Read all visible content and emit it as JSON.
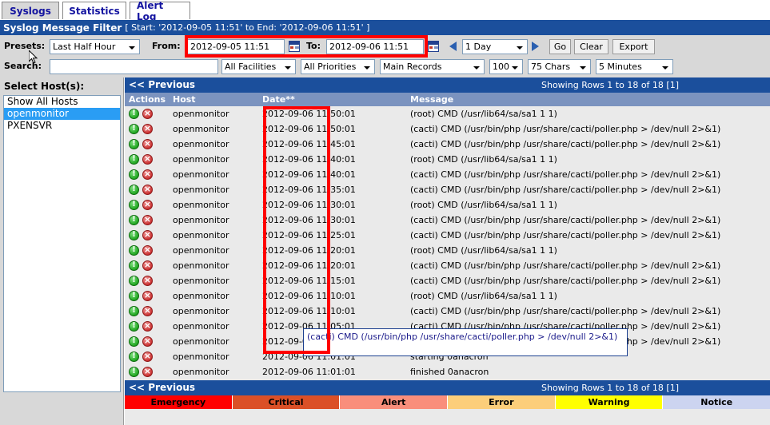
{
  "tabs": [
    {
      "label": "Syslogs",
      "active": true
    },
    {
      "label": "Statistics",
      "active": false
    },
    {
      "label": "Alert Log",
      "active": false
    }
  ],
  "filter_header": {
    "title": "Syslog Message Filter",
    "range": "[ Start: '2012-09-05 11:51' to End: '2012-09-06 11:51' ]"
  },
  "filter_form": {
    "presets_label": "Presets:",
    "presets_value": "Last Half Hour",
    "from_label": "From:",
    "from_value": "2012-09-05 11:51",
    "to_label": "To:",
    "to_value": "2012-09-06 11:51",
    "interval_value": "1 Day",
    "go_label": "Go",
    "clear_label": "Clear",
    "export_label": "Export",
    "search_label": "Search:",
    "search_value": "",
    "search_placeholder": "",
    "facilities_value": "All Facilities",
    "priorities_value": "All Priorities",
    "records_value": "Main Records",
    "rowcount_value": "100",
    "chars_value": "75 Chars",
    "refresh_value": "5 Minutes"
  },
  "hosts_panel": {
    "title": "Select Host(s):",
    "items": [
      {
        "label": "Show All Hosts",
        "selected": false
      },
      {
        "label": "openmonitor",
        "selected": true
      },
      {
        "label": "PXENSVR",
        "selected": false
      }
    ]
  },
  "pager": {
    "previous_label": "<< Previous",
    "showing_label": "Showing Rows 1 to 18 of 18 [1]"
  },
  "table": {
    "columns": [
      "Actions",
      "Host",
      "Date**",
      "Message"
    ],
    "rows": [
      {
        "host": "openmonitor",
        "date": "2012-09-06 11:50:01",
        "message": "(root) CMD (/usr/lib64/sa/sa1 1 1)"
      },
      {
        "host": "openmonitor",
        "date": "2012-09-06 11:50:01",
        "message": "(cacti) CMD (/usr/bin/php /usr/share/cacti/poller.php > /dev/null 2>&1)"
      },
      {
        "host": "openmonitor",
        "date": "2012-09-06 11:45:01",
        "message": "(cacti) CMD (/usr/bin/php /usr/share/cacti/poller.php > /dev/null 2>&1)"
      },
      {
        "host": "openmonitor",
        "date": "2012-09-06 11:40:01",
        "message": "(root) CMD (/usr/lib64/sa/sa1 1 1)"
      },
      {
        "host": "openmonitor",
        "date": "2012-09-06 11:40:01",
        "message": "(cacti) CMD (/usr/bin/php /usr/share/cacti/poller.php > /dev/null 2>&1)"
      },
      {
        "host": "openmonitor",
        "date": "2012-09-06 11:35:01",
        "message": "(cacti) CMD (/usr/bin/php /usr/share/cacti/poller.php > /dev/null 2>&1)"
      },
      {
        "host": "openmonitor",
        "date": "2012-09-06 11:30:01",
        "message": "(root) CMD (/usr/lib64/sa/sa1 1 1)"
      },
      {
        "host": "openmonitor",
        "date": "2012-09-06 11:30:01",
        "message": "(cacti) CMD (/usr/bin/php /usr/share/cacti/poller.php > /dev/null 2>&1)"
      },
      {
        "host": "openmonitor",
        "date": "2012-09-06 11:25:01",
        "message": "(cacti) CMD (/usr/bin/php /usr/share/cacti/poller.php > /dev/null 2>&1)"
      },
      {
        "host": "openmonitor",
        "date": "2012-09-06 11:20:01",
        "message": "(root) CMD (/usr/lib64/sa/sa1 1 1)"
      },
      {
        "host": "openmonitor",
        "date": "2012-09-06 11:20:01",
        "message": "(cacti) CMD (/usr/bin/php /usr/share/cacti/poller.php > /dev/null 2>&1)"
      },
      {
        "host": "openmonitor",
        "date": "2012-09-06 11:15:01",
        "message": "(cacti) CMD (/usr/bin/php /usr/share/cacti/poller.php > /dev/null 2>&1)"
      },
      {
        "host": "openmonitor",
        "date": "2012-09-06 11:10:01",
        "message": "(root) CMD (/usr/lib64/sa/sa1 1 1)"
      },
      {
        "host": "openmonitor",
        "date": "2012-09-06 11:10:01",
        "message": "(cacti) CMD (/usr/bin/php /usr/share/cacti/poller.php > /dev/null 2>&1)"
      },
      {
        "host": "openmonitor",
        "date": "2012-09-06 11:05:01",
        "message": "(cacti) CMD (/usr/bin/php /usr/share/cacti/poller.php > /dev/null 2>&1)"
      },
      {
        "host": "openmonitor",
        "date": "2012-09-06 11:05:01",
        "message": "(cacti) CMD (/usr/bin/php /usr/share/cacti/poller.php > /dev/null 2>&1)"
      },
      {
        "host": "openmonitor",
        "date": "2012-09-06 11:01:01",
        "message": "starting 0anacron"
      },
      {
        "host": "openmonitor",
        "date": "2012-09-06 11:01:01",
        "message": "finished 0anacron"
      }
    ]
  },
  "tooltip": {
    "text": "(cacti) CMD (/usr/bin/php /usr/share/cacti/poller.php > /dev/null 2>&1)"
  },
  "severity_legend": [
    {
      "label": "Emergency",
      "color": "#ff0000"
    },
    {
      "label": "Critical",
      "color": "#db5027"
    },
    {
      "label": "Alert",
      "color": "#f98e7b"
    },
    {
      "label": "Error",
      "color": "#fcce7a"
    },
    {
      "label": "Warning",
      "color": "#ffff00"
    },
    {
      "label": "Notice",
      "color": "#ccd4f0"
    }
  ],
  "annotations": {
    "date_range_highlight": "red-rectangle-around-from-to-date-fields",
    "date_column_highlight": "red-rectangle-around-date-column"
  }
}
